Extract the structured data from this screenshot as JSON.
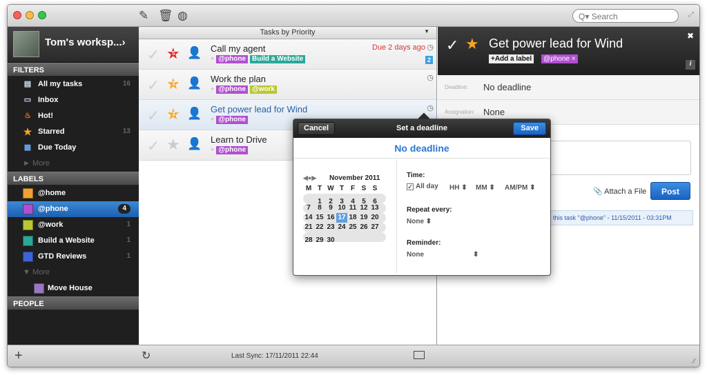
{
  "window": {
    "search_placeholder": "Search",
    "search_prefix": "Q▾"
  },
  "sidebar": {
    "workspace_name": "Tom's worksp...›",
    "filters_header": "FILTERS",
    "filters": [
      {
        "label": "All my tasks",
        "count": "16",
        "icon": "tray-icon"
      },
      {
        "label": "Inbox",
        "count": "",
        "icon": "inbox-icon"
      },
      {
        "label": "Hot!",
        "count": "",
        "icon": "fire-icon"
      },
      {
        "label": "Starred",
        "count": "13",
        "icon": "star-icon"
      },
      {
        "label": "Due Today",
        "count": "",
        "icon": "calendar-icon"
      }
    ],
    "filters_more": "► More",
    "labels_header": "LABELS",
    "labels": [
      {
        "label": "@home",
        "count": "",
        "color": "#f0a030"
      },
      {
        "label": "@phone",
        "count": "4",
        "color": "#b050d0"
      },
      {
        "label": "@work",
        "count": "1",
        "color": "#b8c830"
      },
      {
        "label": "Build a Website",
        "count": "1",
        "color": "#2aa898"
      },
      {
        "label": "GTD Reviews",
        "count": "1",
        "color": "#3a64d8"
      }
    ],
    "labels_more": "▼ More",
    "sub_label": {
      "label": "Move House",
      "color": "#9a78c0"
    },
    "people_header": "PEOPLE"
  },
  "list": {
    "header": "Tasks by Priority",
    "tasks": [
      {
        "title": "Call my agent",
        "star_num": "5",
        "due": "Due 2 days ago",
        "badge": "2",
        "tags": [
          {
            "label": "@phone",
            "color": "#b050d0"
          },
          {
            "label": "Build a Website",
            "color": "#2aa898"
          }
        ]
      },
      {
        "title": "Work the plan",
        "star_num": "3",
        "tags": [
          {
            "label": "@phone",
            "color": "#b050d0"
          },
          {
            "label": "@work",
            "color": "#b8c830"
          }
        ]
      },
      {
        "title": "Get power lead for Wind",
        "star_num": "3",
        "tags": [
          {
            "label": "@phone",
            "color": "#b050d0"
          }
        ]
      },
      {
        "title": "Learn to Drive",
        "star_num": "",
        "tags": [
          {
            "label": "@phone",
            "color": "#b050d0"
          }
        ]
      }
    ]
  },
  "detail": {
    "title": "Get power lead for Wind",
    "add_label": "+Add a label",
    "tag": "@phone ×",
    "deadline_label": "Deadline:",
    "deadline_value": "No deadline",
    "assignation_label": "Assignation:",
    "assignation_value": "None",
    "attach": "Attach a File",
    "post": "Post",
    "activity": "this task \"@phone\" - 11/15/2011 - 03:31PM"
  },
  "popover": {
    "cancel": "Cancel",
    "title": "Set a deadline",
    "save": "Save",
    "no_deadline": "No deadline",
    "month": "November 2011",
    "weekdays": [
      "M",
      "T",
      "W",
      "T",
      "F",
      "S",
      "S"
    ],
    "weeks": [
      [
        "",
        "1",
        "2",
        "3",
        "4",
        "5",
        "6"
      ],
      [
        "7",
        "8",
        "9",
        "10",
        "11",
        "12",
        "13"
      ],
      [
        "14",
        "15",
        "16",
        "17",
        "18",
        "19",
        "20"
      ],
      [
        "21",
        "22",
        "23",
        "24",
        "25",
        "26",
        "27"
      ],
      [
        "28",
        "29",
        "30",
        "",
        "",
        "",
        ""
      ]
    ],
    "today": "17",
    "time_label": "Time:",
    "all_day": "All day",
    "hh": "HH ⬍",
    "mm": "MM ⬍",
    "ampm": "AM/PM ⬍",
    "repeat_label": "Repeat every:",
    "repeat_value": "None ⬍",
    "reminder_label": "Reminder:",
    "reminder_value": "None"
  },
  "bottom": {
    "sync": "Last Sync: 17/11/2011 22:44"
  }
}
